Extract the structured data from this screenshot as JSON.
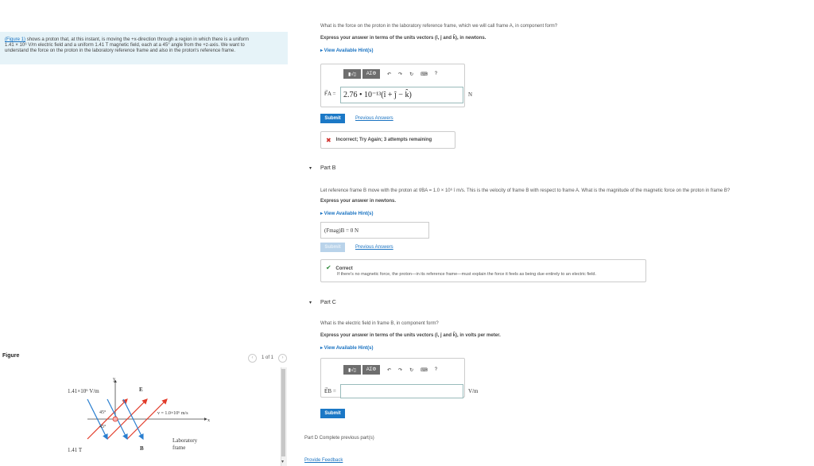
{
  "intro": {
    "figure_link": "(Figure 1)",
    "line1": "shows a proton that, at this instant, is moving the +x-direction through a region in which there is a uniform",
    "line2": "1.41 × 10⁶ V/m electric field and a uniform 1.41 T magnetic field, each at a 45° angle from the +z-axis. We want to",
    "line3": "understand the force on the proton in the laboratory reference frame and also in the proton's reference frame."
  },
  "figure": {
    "title": "Figure",
    "pager": "1 of 1",
    "e_label": "1.41×10⁶ V/m",
    "b_label": "1.41 T",
    "y_axis": "y",
    "x_axis": "x",
    "e_vec": "E",
    "b_vec": "B",
    "angle_top": "45°",
    "angle_bot": "45°",
    "velocity": "v = 1.0×10⁶ m/s",
    "frame_label_1": "Laboratory",
    "frame_label_2": "frame"
  },
  "toolbar": {
    "templates": "▮√▯",
    "greek": "AΣΦ",
    "undo": "↶",
    "redo": "↷",
    "reset": "↻",
    "keyboard": "⌨",
    "help": "?"
  },
  "partA": {
    "question": "What is the force on the proton in the laboratory reference frame, which we will call frame A, in component form?",
    "instruction": "Express your answer in terms of the units vectors (î, ĵ and k̂), in newtons.",
    "hints": "▸ View Available Hint(s)",
    "label": "F⃗A =",
    "value": "2.76 • 10⁻¹³(î + ĵ − k̂)",
    "unit": "N",
    "submit": "Submit",
    "prev": "Previous Answers",
    "feedback_icon": "✖",
    "feedback": "Incorrect; Try Again; 3 attempts remaining"
  },
  "partB": {
    "header": "Part B",
    "question": "Let reference frame B move with the proton at v⃗BA = 1.0 × 10⁶ î m/s. This is the velocity of frame B with respect to frame A. What is the magnitude of the magnetic force on the proton in frame B?",
    "instruction": "Express your answer in newtons.",
    "hints": "▸ View Available Hint(s)",
    "answer": "(Fmag)B = 0 N",
    "submit": "Submit",
    "prev": "Previous Answers",
    "feedback_icon": "✔",
    "feedback_title": "Correct",
    "feedback_body": "If there's no magnetic force, the proton—in its reference frame—must explain the force it feels as being due entirely to an electric field."
  },
  "partC": {
    "header": "Part C",
    "question": "What is the electric field in frame B, in component form?",
    "instruction": "Express your answer in terms of the units vectors (î, ĵ and k̂), in volts per meter.",
    "hints": "▸ View Available Hint(s)",
    "label": "E⃗B =",
    "value": "",
    "unit": "V/m",
    "submit": "Submit"
  },
  "partD": {
    "text": "Part D  Complete previous part(s)"
  },
  "footer": {
    "feedback_link": "Provide Feedback"
  },
  "colors": {
    "e_arrow": "#e23b2a",
    "b_arrow": "#2a7fd0",
    "accent": "#1b78c6"
  }
}
